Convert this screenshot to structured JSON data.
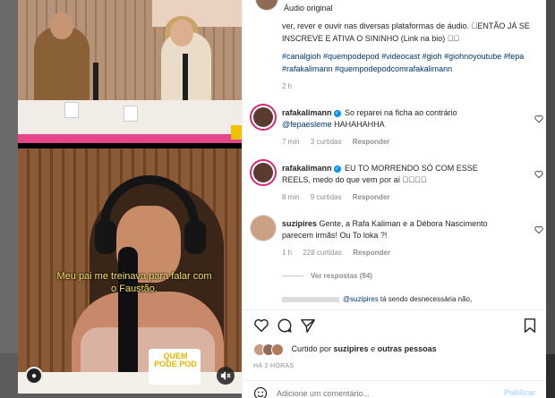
{
  "post": {
    "audio_label": "Áudio original",
    "caption_text": "ver, rever e ouvir nas diversas plataformas de áudio. \u0000ENTÃO JÁ SE INSCREVE E ATIVA O SININHO (Link na bio) \u0000\u0000",
    "hashtags": "#canalgioh #quempodepod #videocast #gioh #giohnoyoutube #fepa #rafakalimann #quempodepodcomrafakalimann",
    "time": "2 h"
  },
  "video": {
    "subtitle": "Meu pai me treinava para falar com o Faustão.",
    "cup_text": "QUEM PODE POD"
  },
  "comments": [
    {
      "user": "rafakalimann",
      "text_plain": " So reparei na ficha ao contrário ",
      "mention": "@fepaesleme",
      "text_after": " HAHAHAHHA",
      "time": "7 min",
      "likes": "3 curtidas",
      "reply": "Responder"
    },
    {
      "user": "rafakalimann",
      "text_plain": " EU TO MORRENDO SÓ COM ESSE REELS, medo do que vem por aí \u0000\u0000\u0000\u0000",
      "mention": "",
      "text_after": "",
      "time": "8 min",
      "likes": "9 curtidas",
      "reply": "Responder"
    },
    {
      "user": "suzipires",
      "text_plain": " Gente, a Rafa Kaliman e a Débora Nascimento parecem irmãs! Ou To loka ?!",
      "mention": "",
      "text_after": "",
      "time": "1 h",
      "likes": "228 curtidas",
      "reply": "Responder"
    }
  ],
  "view_replies": "Ver respostas (94)",
  "sub_reply": {
    "mention": "@suzipires",
    "text": " tá sendo desnecessária não,"
  },
  "liked_by": {
    "prefix": "Curtido por ",
    "user": "suzipires",
    "middle": " e ",
    "others": "outras pessoas"
  },
  "posted_ago": "HÁ 2 HORAS",
  "add_comment": {
    "placeholder": "Adicione um comentário...",
    "publish": "Publicar"
  },
  "colors": {
    "link": "#00376b",
    "verified": "#0095f6",
    "publish_disabled": "#b3dbff",
    "subtitle": "#f7e36a"
  }
}
